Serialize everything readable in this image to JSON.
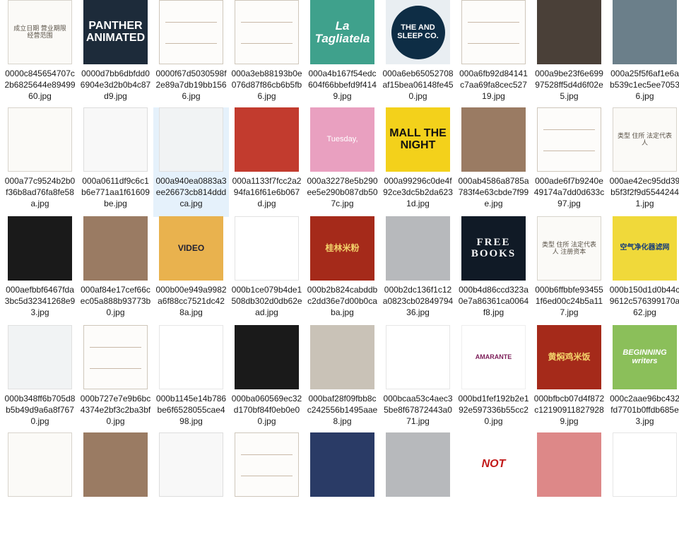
{
  "files": [
    {
      "name": "0000c845654707c2b6825644e8949960.jpg",
      "style": "t-doc",
      "caption": "成立日期 营业期限 经营范围",
      "selected": false
    },
    {
      "name": "0000d7bb6dbfdd06904e3d2b0b4c87d9.jpg",
      "style": "t-dark",
      "caption": "PANTHER ANIMATED",
      "selected": false
    },
    {
      "name": "0000f67d5030598f2e89a7db19bb1566.jpg",
      "style": "t-form",
      "caption": "",
      "selected": false
    },
    {
      "name": "000a3eb88193b0e076d87f86cb6b5fb6.jpg",
      "style": "t-form",
      "caption": "",
      "selected": false
    },
    {
      "name": "000a4b167f54edc604f66bbefd9f4149.jpg",
      "style": "t-green",
      "caption": "La Tagliatela",
      "selected": false
    },
    {
      "name": "000a6eb65052708af15bea06148fe450.jpg",
      "style": "t-circle",
      "caption": "THE AND SLEEP CO.",
      "selected": false
    },
    {
      "name": "000a6fb92d84141c7aa69fa8cec52719.jpg",
      "style": "t-form",
      "caption": "",
      "selected": false
    },
    {
      "name": "000a9be23f6e69997528ff5d4d6f02e5.jpg",
      "style": "t-street",
      "caption": "",
      "selected": false
    },
    {
      "name": "000a25f5f6af1e6ab539c1ec5ee70536.jpg",
      "style": "t-stage",
      "caption": "",
      "selected": false
    },
    {
      "name": "000a77c9524b2b0f36b8ad76fa8fe58a.jpg",
      "style": "t-doc",
      "caption": "",
      "selected": false
    },
    {
      "name": "000a0611df9c6c1b6e771aa1f61609be.jpg",
      "style": "t-phone",
      "caption": "",
      "selected": false
    },
    {
      "name": "000a940ea0883a3ee26673cb814dddca.jpg",
      "style": "t-android",
      "caption": "",
      "selected": true
    },
    {
      "name": "000a1133f7fcc2a294fa16f61e6b067d.jpg",
      "style": "t-can",
      "caption": "",
      "selected": false
    },
    {
      "name": "000a32278e5b290ee5e290b087db507c.jpg",
      "style": "t-pink",
      "caption": "Tuesday,",
      "selected": false
    },
    {
      "name": "000a99296c0de4f92ce3dc5b2da6231d.jpg",
      "style": "t-yellow",
      "caption": "MALL THE NIGHT",
      "selected": false
    },
    {
      "name": "000ab4586a8785a783f4e63cbde7f99e.jpg",
      "style": "t-photo",
      "caption": "",
      "selected": false
    },
    {
      "name": "000ade6f7b9240e49174a7dd0d633c97.jpg",
      "style": "t-form",
      "caption": "",
      "selected": false
    },
    {
      "name": "000ae42ec95dd39b5f3f2f9d55442441.jpg",
      "style": "t-doc",
      "caption": "类型 住所 法定代表人",
      "selected": false
    },
    {
      "name": "000aefbbf6467fda3bc5d32341268e93.jpg",
      "style": "t-dark2",
      "caption": "",
      "selected": false
    },
    {
      "name": "000af84e17cef66cec05a888b93773b0.jpg",
      "style": "t-photo",
      "caption": "",
      "selected": false
    },
    {
      "name": "000b00e949a9982a6f88cc7521dc428a.jpg",
      "style": "t-video",
      "caption": "VIDEO",
      "selected": false
    },
    {
      "name": "000b1ce079b4de1508db302d0db62ead.jpg",
      "style": "t-grid",
      "caption": "",
      "selected": false
    },
    {
      "name": "000b2b824cabddbc2dd36e7d00b0caba.jpg",
      "style": "t-sign",
      "caption": "桂林米粉",
      "selected": false
    },
    {
      "name": "000b2dc136f1c12a0823cb0284979436.jpg",
      "style": "t-metal",
      "caption": "",
      "selected": false
    },
    {
      "name": "000b4d86ccd323a0e7a86361ca0064f8.jpg",
      "style": "t-free",
      "caption": "FREE BOOKS",
      "selected": false
    },
    {
      "name": "000b6ffbbfe934551f6ed00c24b5a117.jpg",
      "style": "t-doc",
      "caption": "类型 住所 法定代表人 注册资本",
      "selected": false
    },
    {
      "name": "000b150d1d0b44c9612c576399170a62.jpg",
      "style": "t-poster",
      "caption": "空气净化器滤网",
      "selected": false
    },
    {
      "name": "000b348ff6b705d8b5b49d9a6a8f7670.jpg",
      "style": "t-android",
      "caption": "",
      "selected": false
    },
    {
      "name": "000b727e7e9b6bc4374e2bf3c2ba3bf0.jpg",
      "style": "t-form",
      "caption": "",
      "selected": false
    },
    {
      "name": "000b1145e14b786be6f6528055cae498.jpg",
      "style": "t-strip",
      "caption": "",
      "selected": false
    },
    {
      "name": "000ba060569ec32d170bf84f0eb0e00.jpg",
      "style": "t-dark2",
      "caption": "",
      "selected": false
    },
    {
      "name": "000baf28f09fbb8cc242556b1495aae8.jpg",
      "style": "t-tower",
      "caption": "",
      "selected": false
    },
    {
      "name": "000bcaa53c4aec35be8f67872443a071.jpg",
      "style": "t-strip",
      "caption": "",
      "selected": false
    },
    {
      "name": "000bd1fef192b2e192e597336b55cc20.jpg",
      "style": "t-logo",
      "caption": "AMARANTE",
      "selected": false
    },
    {
      "name": "000bfbcb07d4f872c121909118279289.jpg",
      "style": "t-sign",
      "caption": "黄焖鸡米饭",
      "selected": false
    },
    {
      "name": "000c2aae96bc432fd7701b0ffdb685e3.jpg",
      "style": "t-child",
      "caption": "BEGINNING writers",
      "selected": false
    },
    {
      "name": "",
      "style": "t-doc",
      "caption": "",
      "selected": false
    },
    {
      "name": "",
      "style": "t-photo",
      "caption": "",
      "selected": false
    },
    {
      "name": "",
      "style": "t-phone",
      "caption": "",
      "selected": false
    },
    {
      "name": "",
      "style": "t-form",
      "caption": "",
      "selected": false
    },
    {
      "name": "",
      "style": "t-news",
      "caption": "",
      "selected": false
    },
    {
      "name": "",
      "style": "t-metal",
      "caption": "",
      "selected": false
    },
    {
      "name": "",
      "style": "t-red",
      "caption": "NOT",
      "selected": false
    },
    {
      "name": "",
      "style": "t-dresses",
      "caption": "",
      "selected": false
    },
    {
      "name": "",
      "style": "t-strip",
      "caption": "",
      "selected": false
    }
  ]
}
